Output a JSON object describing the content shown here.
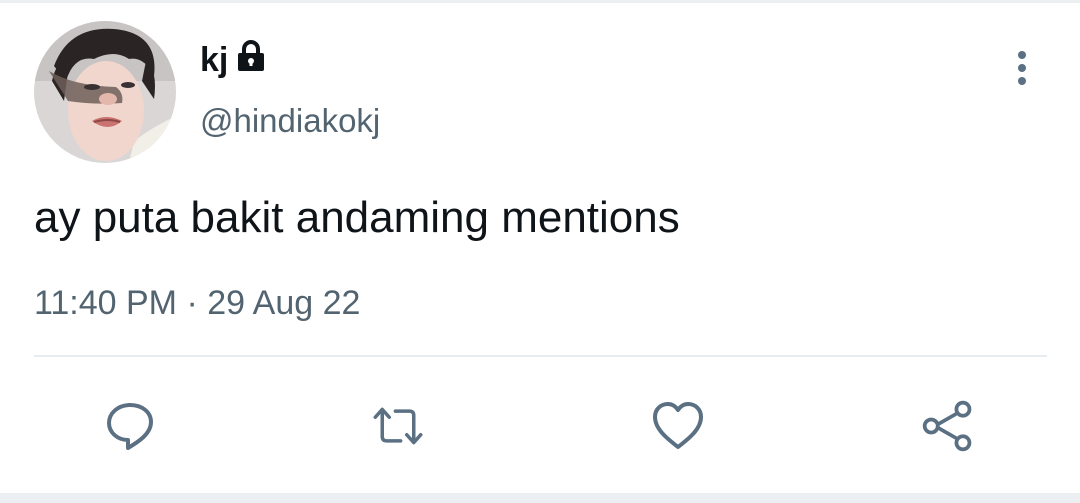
{
  "tweet": {
    "author": {
      "display_name": "kj",
      "handle": "@hindiakokj",
      "protected_icon": "lock-icon",
      "avatar": "profile-photo"
    },
    "text": "ay puta bakit andaming mentions",
    "time": "11:40 PM",
    "separator": "·",
    "date": "29 Aug 22",
    "menu_icon": "more-vertical-icon"
  },
  "actions": [
    {
      "name": "reply",
      "icon": "reply-icon"
    },
    {
      "name": "retweet",
      "icon": "retweet-icon"
    },
    {
      "name": "like",
      "icon": "heart-icon"
    },
    {
      "name": "share",
      "icon": "share-icon"
    }
  ],
  "colors": {
    "text_primary": "#0f1419",
    "text_secondary": "#536471",
    "icon": "#5b7083",
    "divider": "#e6ecf0"
  }
}
